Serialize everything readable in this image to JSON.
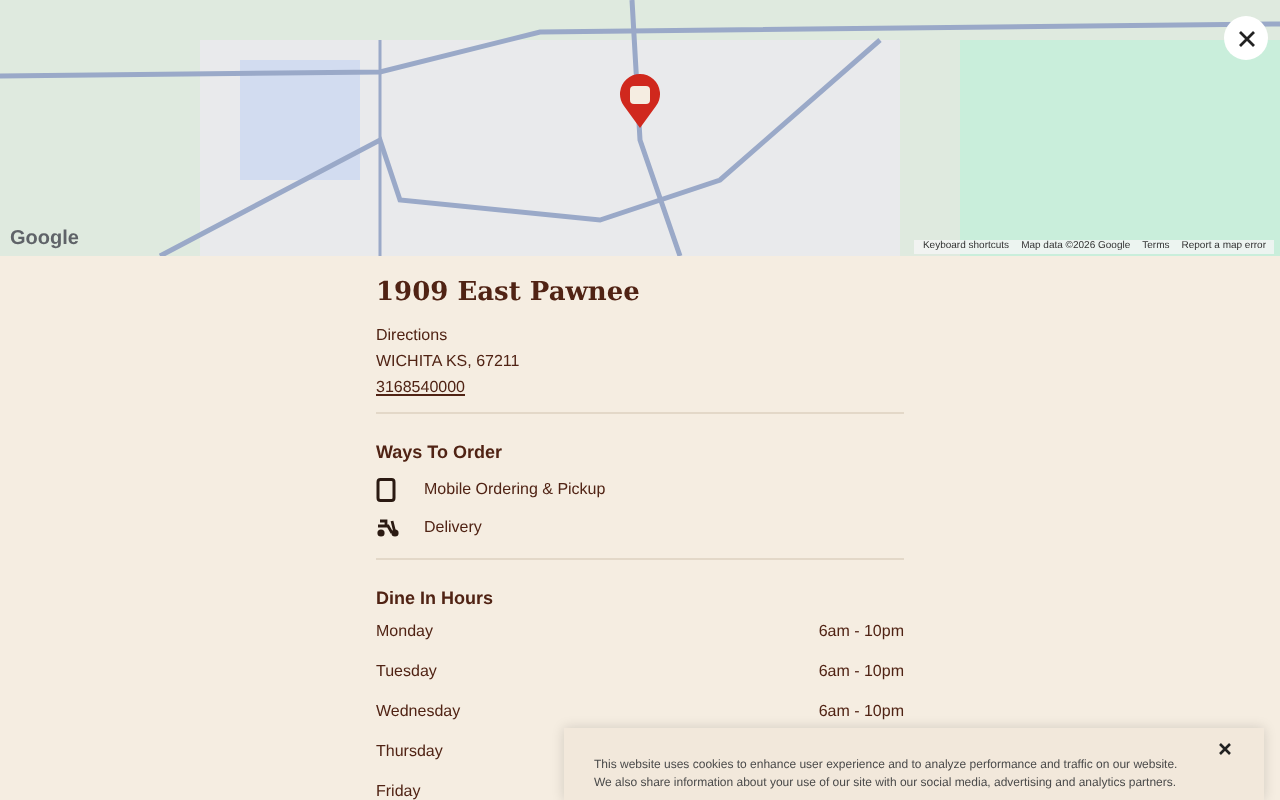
{
  "map": {
    "logo": "Google",
    "attribution": [
      "Keyboard shortcuts",
      "Map data ©2026 Google",
      "Terms",
      "Report a map error"
    ]
  },
  "store": {
    "name": "1909 East Pawnee",
    "directions": "Directions",
    "address": "WICHITA KS, 67211",
    "phone": "3168540000"
  },
  "ways_to_order": {
    "title": "Ways To Order",
    "items": [
      {
        "kind": "mobile",
        "label": "Mobile Ordering & Pickup"
      },
      {
        "kind": "delivery",
        "label": "Delivery"
      }
    ]
  },
  "dine_in_hours": {
    "title": "Dine In Hours",
    "rows": [
      {
        "day": "Monday",
        "hours": "6am - 10pm"
      },
      {
        "day": "Tuesday",
        "hours": "6am - 10pm"
      },
      {
        "day": "Wednesday",
        "hours": "6am - 10pm"
      },
      {
        "day": "Thursday",
        "hours": ""
      },
      {
        "day": "Friday",
        "hours": ""
      }
    ]
  },
  "cookie_banner": {
    "lines": [
      "This website uses cookies to enhance user experience and to analyze performance and traffic on our website.",
      "We also share information about your use of our site with our social media, advertising and analytics partners."
    ]
  }
}
